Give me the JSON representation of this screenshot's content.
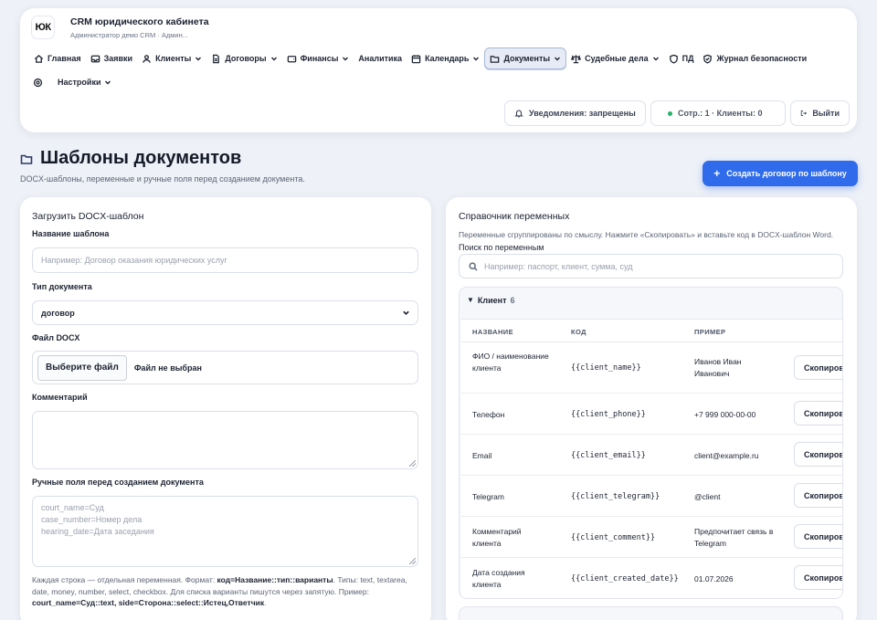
{
  "brand": {
    "logo": "ЮК",
    "title": "CRM юридического кабинета",
    "subtitle": "Администратор демо CRM · Админ..."
  },
  "nav": {
    "items": [
      {
        "label": "Главная",
        "icon": "home-icon"
      },
      {
        "label": "Заявки",
        "icon": "inbox-icon"
      },
      {
        "label": "Клиенты",
        "icon": "user-icon",
        "dropdown": true
      },
      {
        "label": "Договоры",
        "icon": "document-icon",
        "dropdown": true
      },
      {
        "label": "Финансы",
        "icon": "wallet-icon",
        "dropdown": true
      },
      {
        "label": "Аналитика",
        "icon": "",
        "dropdown": false
      },
      {
        "label": "Календарь",
        "icon": "calendar-icon",
        "dropdown": true
      },
      {
        "label": "Документы",
        "icon": "folder-icon",
        "dropdown": true,
        "active": true
      },
      {
        "label": "Судебные дела",
        "icon": "scales-icon",
        "dropdown": true
      },
      {
        "label": "ПД",
        "icon": "shield-icon"
      },
      {
        "label": "Журнал безопасности",
        "icon": "shield-check-icon"
      }
    ],
    "settings_label": "Настройки"
  },
  "top_actions": {
    "notifications": "Уведомления: запрещены",
    "stats": "Сотр.: 1 · Клиенты: 0",
    "logout": "Выйти"
  },
  "page": {
    "title": "Шаблоны документов",
    "subtitle": "DOCX-шаблоны, переменные и ручные поля перед созданием документа.",
    "create_button": "Создать договор по шаблону"
  },
  "upload": {
    "title": "Загрузить DOCX-шаблон",
    "name_label": "Название шаблона",
    "name_placeholder": "Например: Договор оказания юридических услуг",
    "type_label": "Тип документа",
    "type_value": "договор",
    "file_label": "Файл DOCX",
    "file_button": "Выберите файл",
    "file_status": "Файл не выбран",
    "comment_label": "Комментарий",
    "manual_label": "Ручные поля перед созданием документа",
    "manual_placeholder": "court_name=Суд\ncase_number=Номер дела\nhearing_date=Дата заседания",
    "hint_1": "Каждая строка — отдельная переменная. Формат: ",
    "hint_format": "код=Название::тип::варианты",
    "hint_2": ". Типы: text, textarea, date, money, number, select, checkbox. Для списка варианты пишутся через запятую. Пример: ",
    "hint_example": "court_name=Суд::text, side=Сторона::select::Истец,Ответчик",
    "hint_3": "."
  },
  "reference": {
    "title": "Справочник переменных",
    "description": "Переменные сгруппированы по смыслу. Нажмите «Скопировать» и вставьте код в DOCX-шаблон Word.",
    "search_label": "Поиск по переменным",
    "search_placeholder": "Например: паспорт, клиент, сумма, суд",
    "group": {
      "name": "Клиент",
      "count": "6"
    },
    "columns": [
      "НАЗВАНИЕ",
      "КОД",
      "ПРИМЕР"
    ],
    "copy_label": "Скопировать",
    "rows": [
      {
        "name": "ФИО / наименование клиента",
        "code": "{{client_name}}",
        "example": "Иванов Иван Иванович"
      },
      {
        "name": "Телефон",
        "code": "{{client_phone}}",
        "example": "+7 999 000-00-00"
      },
      {
        "name": "Email",
        "code": "{{client_email}}",
        "example": "client@example.ru"
      },
      {
        "name": "Telegram",
        "code": "{{client_telegram}}",
        "example": "@client"
      },
      {
        "name": "Комментарий клиента",
        "code": "{{client_comment}}",
        "example": "Предпочитает связь в Telegram"
      },
      {
        "name": "Дата создания клиента",
        "code": "{{client_created_date}}",
        "example": "01.07.2026"
      }
    ]
  }
}
